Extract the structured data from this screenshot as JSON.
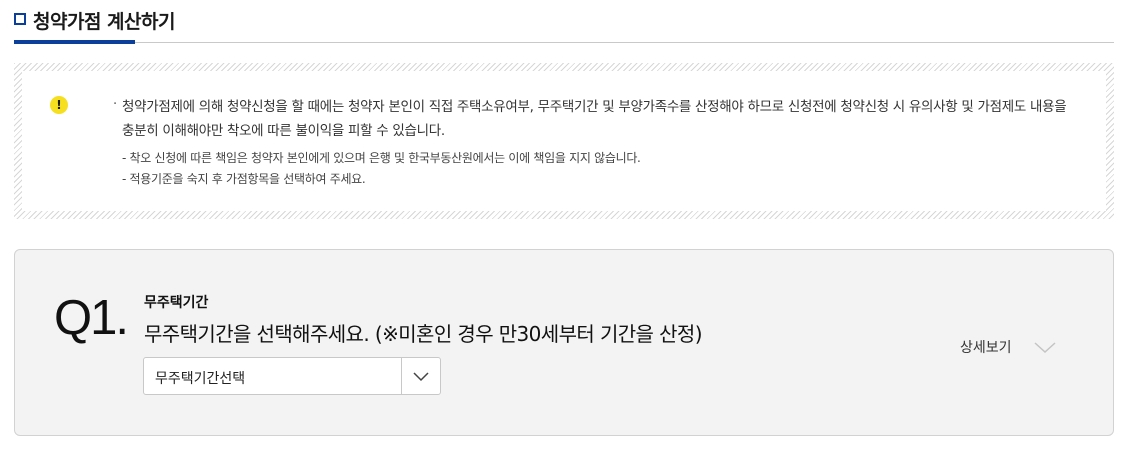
{
  "header": {
    "title": "청약가점 계산하기",
    "accent_color": "#0b3f9a"
  },
  "notice": {
    "icon": "warning-icon",
    "icon_glyph": "!",
    "bullet": "·",
    "main_text": "청약가점제에 의해 청약신청을 할 때에는 청약자 본인이 직접 주택소유여부, 무주택기간 및 부양가족수를 산정해야 하므로 신청전에 청약신청 시 유의사항 및 가점제도 내용을 충분히 이해해야만 착오에 따른 불이익을 피할 수 있습니다.",
    "sub_notes": [
      "- 착오 신청에 따른 책임은 청약자 본인에게 있으며 은행 및 한국부동산원에서는 이에 책임을 지지 않습니다.",
      "- 적용기준을 숙지 후 가점항목을 선택하여 주세요."
    ]
  },
  "question": {
    "number": "Q1.",
    "title": "무주택기간",
    "text": "무주택기간을 선택해주세요. (※미혼인 경우 만30세부터 기간을 산정)",
    "select": {
      "value": "무주택기간선택",
      "icon": "chevron-down-icon"
    },
    "detail_label": "상세보기",
    "detail_icon": "chevron-down-icon"
  }
}
